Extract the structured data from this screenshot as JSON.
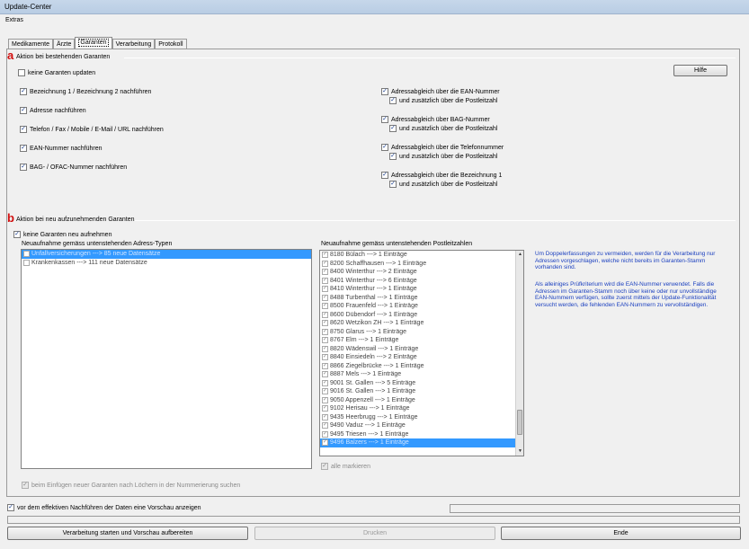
{
  "window": {
    "title": "Update-Center"
  },
  "menu": {
    "extras": "Extras"
  },
  "tabs": [
    {
      "label": "Medikamente"
    },
    {
      "label": "Ärzte"
    },
    {
      "label": "Garanten"
    },
    {
      "label": "Verarbeitung"
    },
    {
      "label": "Protokoll"
    }
  ],
  "section_a": {
    "marker": "a",
    "title": "Aktion bei bestehenden Garanten",
    "no_update": {
      "label": "keine Garanten updaten",
      "checked": false
    },
    "help_button": "Hilfe",
    "left_options": [
      {
        "label": "Bezeichnung 1 / Bezeichnung 2 nachführen",
        "checked": true
      },
      {
        "label": "Adresse nachführen",
        "checked": true
      },
      {
        "label": "Telefon / Fax / Mobile / E-Mail / URL nachführen",
        "checked": true
      },
      {
        "label": "EAN-Nummer nachführen",
        "checked": true
      },
      {
        "label": "BAG- / OFAC-Nummer nachführen",
        "checked": true
      }
    ],
    "right_options": [
      {
        "label": "Adressabgleich über die EAN-Nummer",
        "checked": true,
        "sub": "und zusätzlich über die Postleitzahl"
      },
      {
        "label": "Adressabgleich über BAG-Nummer",
        "checked": true,
        "sub": "und zusätzlich über die Postleitzahl"
      },
      {
        "label": "Adressabgleich über die Telefonnummer",
        "checked": true,
        "sub": "und zusätzlich über die Postleitzahl"
      },
      {
        "label": "Adressabgleich über die Bezeichnung 1",
        "checked": true,
        "sub": "und zusätzlich über die Postleitzahl"
      }
    ]
  },
  "section_b": {
    "marker": "b",
    "title": "Aktion bei neu aufzunehmenden Garanten",
    "no_new": {
      "label": "keine Garanten neu aufnehmen",
      "checked": true
    },
    "address_types_title": "Neuaufnahme gemäss untenstehenden Adress-Typen",
    "address_types": [
      {
        "label": "Unfallversicherungen   ---> 85 neue Datensätze",
        "selected": true
      },
      {
        "label": "Krankenkassen   ---> 111 neue Datensätze",
        "selected": false
      }
    ],
    "postal_title": "Neuaufnahme gemäss untenstehenden Postleitzahlen",
    "postal_codes": [
      "8180 Bülach   ---> 1 Einträge",
      "8200 Schaffhausen   ---> 1 Einträge",
      "8400 Winterthur   ---> 2 Einträge",
      "8401 Winterthur   ---> 6 Einträge",
      "8410 Winterthur   ---> 1 Einträge",
      "8488 Turbenthal   ---> 1 Einträge",
      "8500 Frauenfeld   ---> 1 Einträge",
      "8600 Dübendorf   ---> 1 Einträge",
      "8620 Wetzikon ZH   ---> 1 Einträge",
      "8750 Glarus   ---> 1 Einträge",
      "8767 Elm   ---> 1 Einträge",
      "8820 Wädenswil   ---> 1 Einträge",
      "8840 Einsiedeln   ---> 2 Einträge",
      "8866 Ziegelbrücke   ---> 1 Einträge",
      "8887 Mels   ---> 1 Einträge",
      "9001 St. Gallen   ---> 5 Einträge",
      "9016 St. Gallen   ---> 1 Einträge",
      "9050 Appenzell   ---> 1 Einträge",
      "9102 Herisau   ---> 1 Einträge",
      "9435 Heerbrugg   ---> 1 Einträge",
      "9490 Vaduz   ---> 1 Einträge",
      "9495 Triesen   ---> 1 Einträge",
      "9496 Balzers   ---> 1 Einträge"
    ],
    "selected_postal_index": 22,
    "mark_all": {
      "label": "alle markieren",
      "checked": true
    },
    "info_paragraph_1": "Um Doppelerfassungen zu vermeiden, werden für die Verarbeitung nur Adressen vorgeschlagen, welche nicht bereits im Garanten-Stamm vorhanden sind.",
    "info_paragraph_2": "Als alleiniges Prüfkriterium wird die EAN-Nummer verwendet. Falls die Adressen im Garanten-Stamm noch über keine oder nur unvollständige EAN-Nummern verfügen, sollte zuerst mittels der Update-Funktionalität versucht werden, die fehlenden EAN-Nummern zu vervollständigen.",
    "gap_option": {
      "label": "beim Einfügen neuer Garanten nach Löchern in der Nummerierung suchen",
      "checked": true
    }
  },
  "footer": {
    "preview": {
      "label": "vor dem effektiven Nachführen der Daten eine Vorschau anzeigen",
      "checked": true
    },
    "btn_start": "Verarbeitung starten und Vorschau aufbereiten",
    "btn_print": "Drucken",
    "btn_end": "Ende"
  },
  "colors": {
    "marker": "#d10f0f",
    "selection": "#3399ff",
    "info_text": "#1a3fbf"
  }
}
